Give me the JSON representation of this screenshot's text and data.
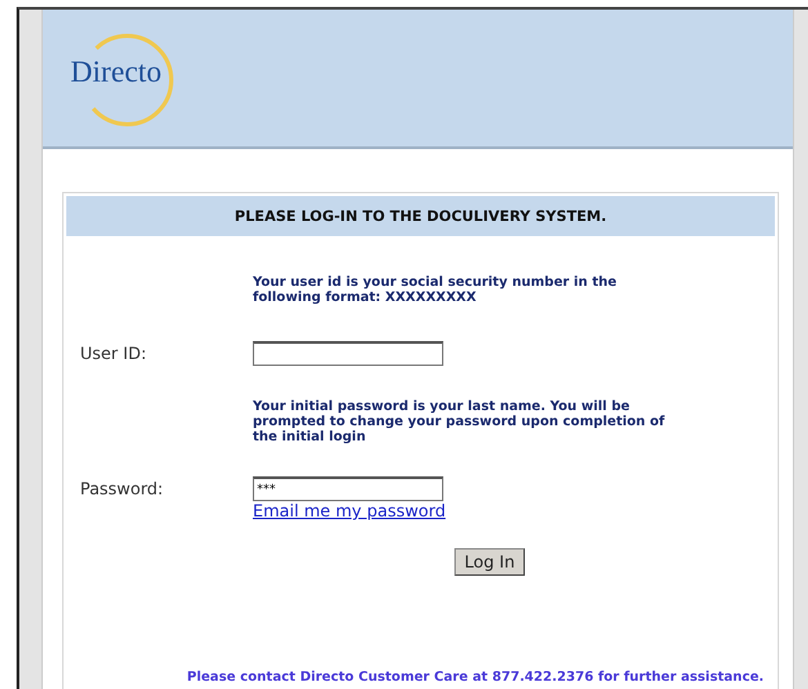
{
  "logo": {
    "text": "Directo"
  },
  "panel": {
    "title": "PLEASE LOG-IN TO THE DOCULIVERY SYSTEM.",
    "user_hint": "Your user id is your social security number in the following format: XXXXXXXXX",
    "user_label": "User ID:",
    "password_hint": "Your initial password is your last name. You will be prompted to change your password upon completion of the initial login",
    "password_label": "Password:",
    "password_value": "***",
    "email_link": "Email me my password",
    "login_button": "Log In",
    "footer": "Please contact Directo Customer Care at 877.422.2376 for further assistance."
  }
}
